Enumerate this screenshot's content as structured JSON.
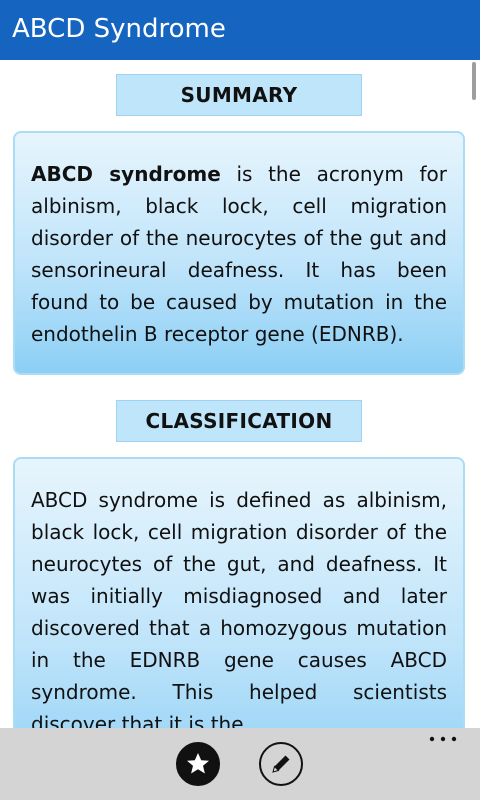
{
  "app": {
    "title": "ABCD Syndrome"
  },
  "sections": [
    {
      "header": "SUMMARY",
      "term": "ABCD syndrome",
      "text": " is the acronym for albinism, black lock, cell migration disorder of the neurocytes of the gut and sensorineural deafness. It has been found to be caused by mutation in the endothelin B receptor gene (EDNRB)."
    },
    {
      "header": "CLASSIFICATION",
      "text": "ABCD syndrome is defined as albinism, black lock, cell migration disorder of the neurocytes of the gut, and deafness. It was initially misdiagnosed and later discovered that a homozygous mutation in the EDNRB gene causes ABCD syndrome. This helped scientists discover that it is the"
    }
  ],
  "appbar": {
    "buttons": [
      {
        "icon": "star-icon"
      },
      {
        "icon": "pencil-icon"
      }
    ],
    "more_icon": "more-icon"
  },
  "colors": {
    "title_bar": "#1565c0",
    "header_bg": "#bfe5fb",
    "card_top": "#e7f5fd",
    "card_bottom": "#8ccff5",
    "appbar_bg": "#d4d4d4"
  }
}
